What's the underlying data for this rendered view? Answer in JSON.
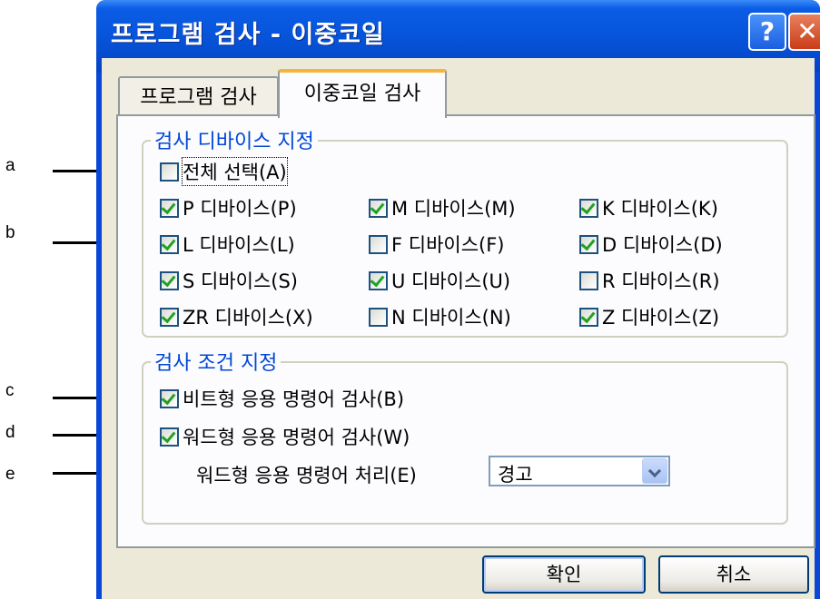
{
  "window": {
    "title": "프로그램 검사 - 이중코일",
    "help_glyph": "?",
    "close_glyph": "✕"
  },
  "tabs": [
    {
      "label": "프로그램 검사",
      "active": false
    },
    {
      "label": "이중코일 검사",
      "active": true
    }
  ],
  "device_group": {
    "label": "검사 디바이스 지정",
    "select_all": {
      "label": "전체 선택(A)",
      "checked": false
    },
    "devices": [
      {
        "label": "P 디바이스(P)",
        "checked": true
      },
      {
        "label": "M 디바이스(M)",
        "checked": true
      },
      {
        "label": "K 디바이스(K)",
        "checked": true
      },
      {
        "label": "L 디바이스(L)",
        "checked": true
      },
      {
        "label": "F 디바이스(F)",
        "checked": false
      },
      {
        "label": "D 디바이스(D)",
        "checked": true
      },
      {
        "label": "S 디바이스(S)",
        "checked": true
      },
      {
        "label": "U 디바이스(U)",
        "checked": true
      },
      {
        "label": "R 디바이스(R)",
        "checked": false
      },
      {
        "label": "ZR 디바이스(X)",
        "checked": true
      },
      {
        "label": "N 디바이스(N)",
        "checked": false
      },
      {
        "label": "Z 디바이스(Z)",
        "checked": true
      }
    ]
  },
  "condition_group": {
    "label": "검사 조건 지정",
    "bit_check": {
      "label": "비트형 응용 명령어 검사(B)",
      "checked": true
    },
    "word_check": {
      "label": "워드형 응용 명령어 검사(W)",
      "checked": true
    },
    "word_process": {
      "label": "워드형 응용 명령어 처리(E)",
      "value": "경고"
    }
  },
  "buttons": {
    "ok": "확인",
    "cancel": "취소"
  },
  "callouts": [
    "a",
    "b",
    "c",
    "d",
    "e"
  ]
}
